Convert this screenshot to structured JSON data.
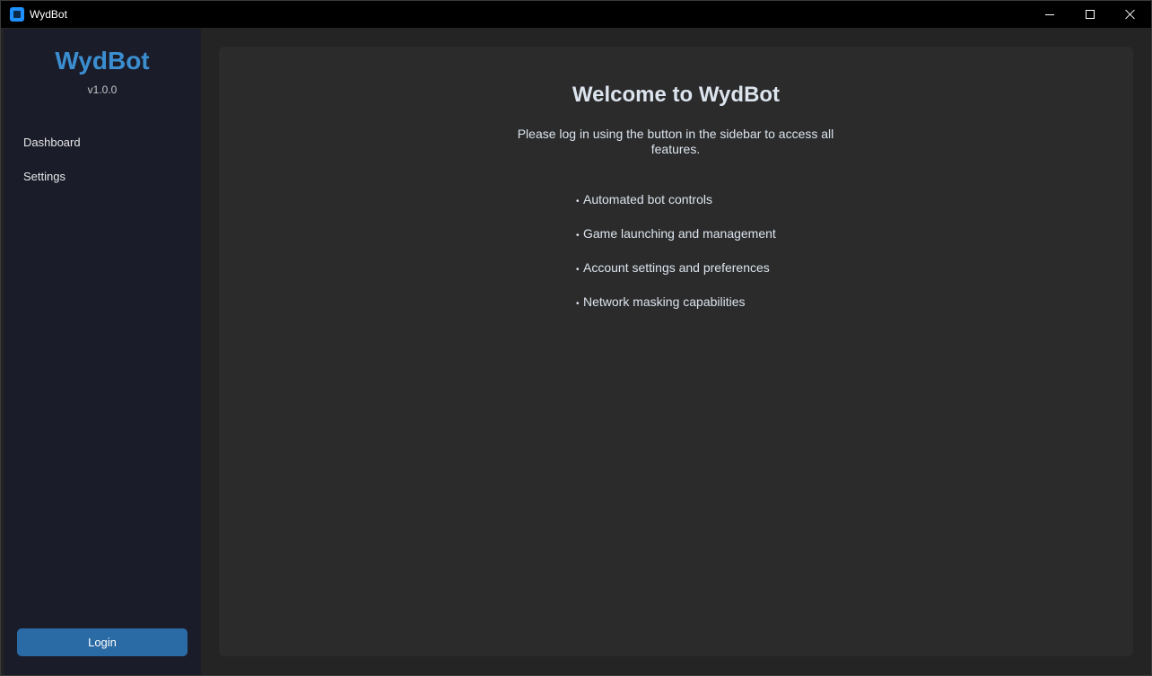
{
  "window": {
    "title": "WydBot",
    "minimize": "minimize",
    "maximize": "maximize",
    "close": "close"
  },
  "sidebar": {
    "brand": "WydBot",
    "version": "v1.0.0",
    "items": [
      {
        "label": "Dashboard"
      },
      {
        "label": "Settings"
      }
    ],
    "login_label": "Login"
  },
  "main": {
    "title": "Welcome to WydBot",
    "subtitle": "Please log in using the button in the sidebar to access all features.",
    "bullet": "•",
    "features": [
      "Automated bot controls",
      "Game launching and management",
      "Account settings and preferences",
      "Network masking capabilities"
    ]
  },
  "colors": {
    "accent": "#3b8ed0",
    "button": "#2a6aa5",
    "sidebar_bg": "#1b1c2a",
    "panel_bg": "#2b2b2b",
    "main_bg": "#242424"
  },
  "icons": {
    "app": "app-icon",
    "minimize": "minimize-icon",
    "maximize": "maximize-icon",
    "close": "close-icon"
  }
}
